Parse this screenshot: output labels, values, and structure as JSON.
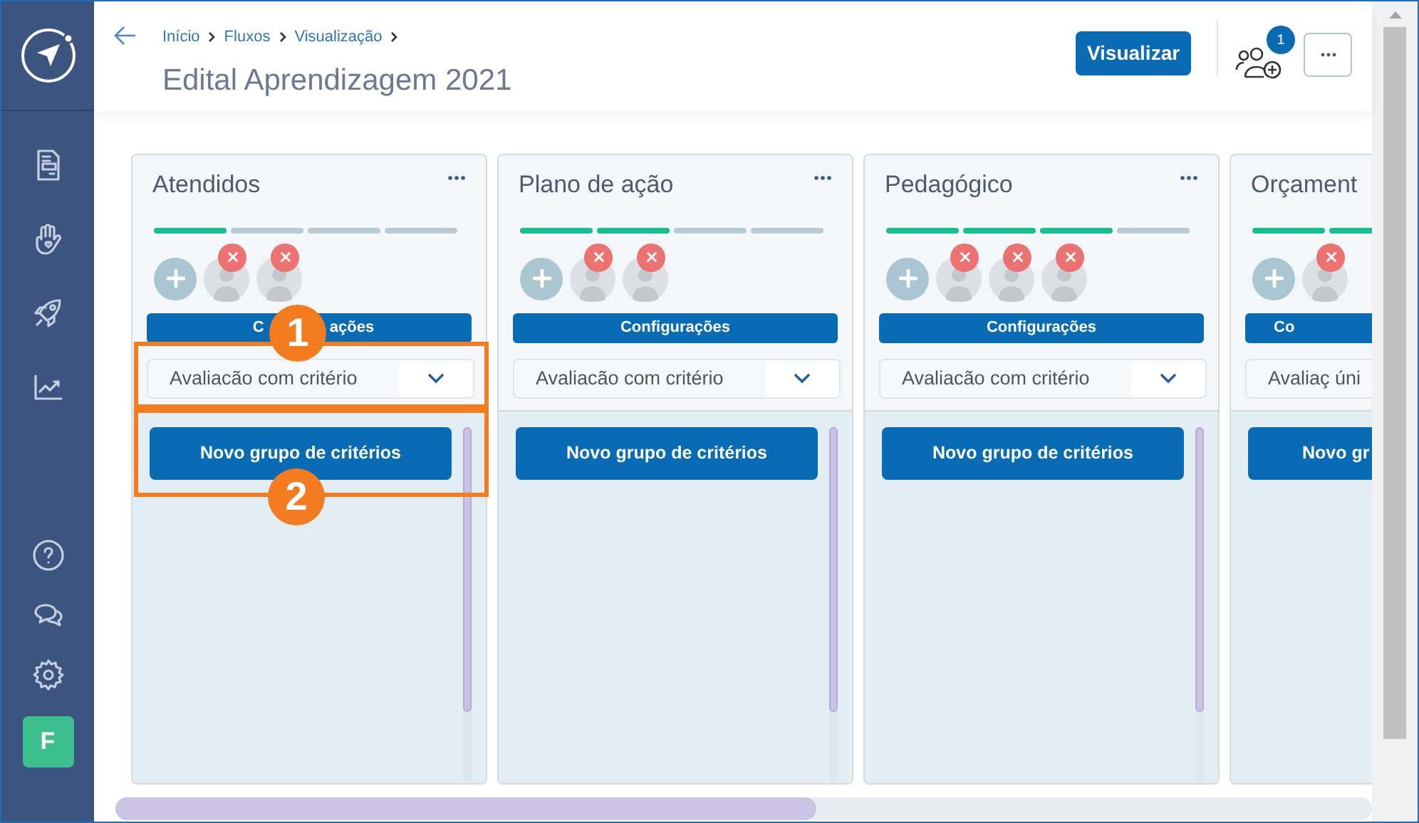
{
  "breadcrumbs": [
    "Início",
    "Fluxos",
    "Visualização"
  ],
  "title": "Edital Aprendizagem 2021",
  "header": {
    "primary_button": "Visualizar",
    "members_badge": "1"
  },
  "sidebar": {
    "items": [
      {
        "kind": "document"
      },
      {
        "kind": "hand"
      },
      {
        "kind": "rocket"
      },
      {
        "kind": "chart"
      }
    ],
    "bottom_items": [
      {
        "kind": "help"
      },
      {
        "kind": "chat"
      },
      {
        "kind": "settings"
      }
    ],
    "avatar": "F"
  },
  "columns": [
    {
      "title": "Atendidos",
      "steps": [
        {
          "done": true
        },
        {
          "done": false
        },
        {
          "done": false
        },
        {
          "done": false
        }
      ],
      "members": [
        {
          "removable": true
        },
        {
          "removable": true
        }
      ],
      "config_button": [
        "C",
        "ações"
      ],
      "select": "Avaliacão com critério",
      "new_button": "Novo grupo de critérios"
    },
    {
      "title": "Plano de ação",
      "steps": [
        {
          "done": true
        },
        {
          "done": true
        },
        {
          "done": false
        },
        {
          "done": false
        }
      ],
      "members": [
        {
          "removable": true
        },
        {
          "removable": true
        }
      ],
      "config_button": "Configurações",
      "select": "Avaliacão com critério",
      "new_button": "Novo grupo de critérios"
    },
    {
      "title": "Pedagógico",
      "steps": [
        {
          "done": true
        },
        {
          "done": true
        },
        {
          "done": true
        },
        {
          "done": false
        }
      ],
      "members": [
        {
          "removable": true
        },
        {
          "removable": true
        },
        {
          "removable": true
        }
      ],
      "config_button": "Configurações",
      "select": "Avaliacão com critério",
      "new_button": "Novo grupo de critérios"
    },
    {
      "title": "Orçament",
      "partial": true,
      "steps": [
        {
          "done": true
        },
        {
          "done": true
        }
      ],
      "members": [
        {
          "removable": true
        }
      ],
      "config_button": "Co",
      "select": "Avaliaç úni",
      "new_button": "Novo gr"
    }
  ],
  "callouts": [
    "1",
    "2"
  ]
}
